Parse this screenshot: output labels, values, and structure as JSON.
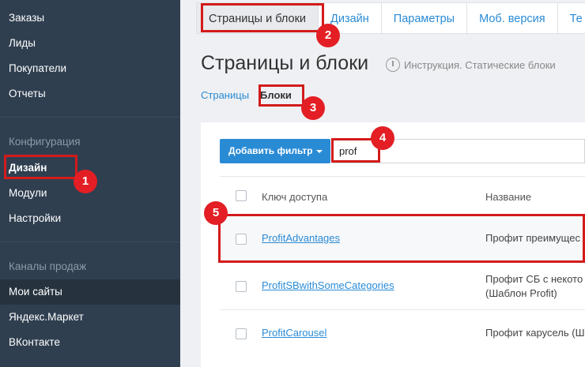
{
  "sidebar": {
    "items_top": [
      "Заказы",
      "Лиды",
      "Покупатели",
      "Отчеты"
    ],
    "config_heading": "Конфигурация",
    "config_items": [
      "Дизайн",
      "Модули",
      "Настройки"
    ],
    "channels_heading": "Каналы продаж",
    "channel_items": [
      "Мои сайты",
      "Яндекс.Маркет",
      "ВКонтакте"
    ]
  },
  "tabs": [
    "Страницы и блоки",
    "Дизайн",
    "Параметры",
    "Моб. версия",
    "Те"
  ],
  "page_title": "Страницы и блоки",
  "help_text": "Инструкция. Статические блоки",
  "subtabs": {
    "pages": "Страницы",
    "blocks": "Блоки"
  },
  "filter": {
    "button_label": "Добавить фильтр",
    "input_value": "prof"
  },
  "table": {
    "col_key": "Ключ доступа",
    "col_name": "Название",
    "rows": [
      {
        "key": "ProfitAdvantages",
        "name_line1": "Профит преимущес",
        "name_line2": ""
      },
      {
        "key": "ProfitSBwithSomeCategories",
        "name_line1": "Профит СБ с некото",
        "name_line2": "(Шаблон Profit)"
      },
      {
        "key": "ProfitCarousel",
        "name_line1": "Профит карусель (Ш",
        "name_line2": ""
      }
    ]
  },
  "annotations": [
    "1",
    "2",
    "3",
    "4",
    "5"
  ],
  "colors": {
    "sidebar_bg": "#2f3f50",
    "accent": "#2a8bd5",
    "annotation": "#e31e24"
  }
}
